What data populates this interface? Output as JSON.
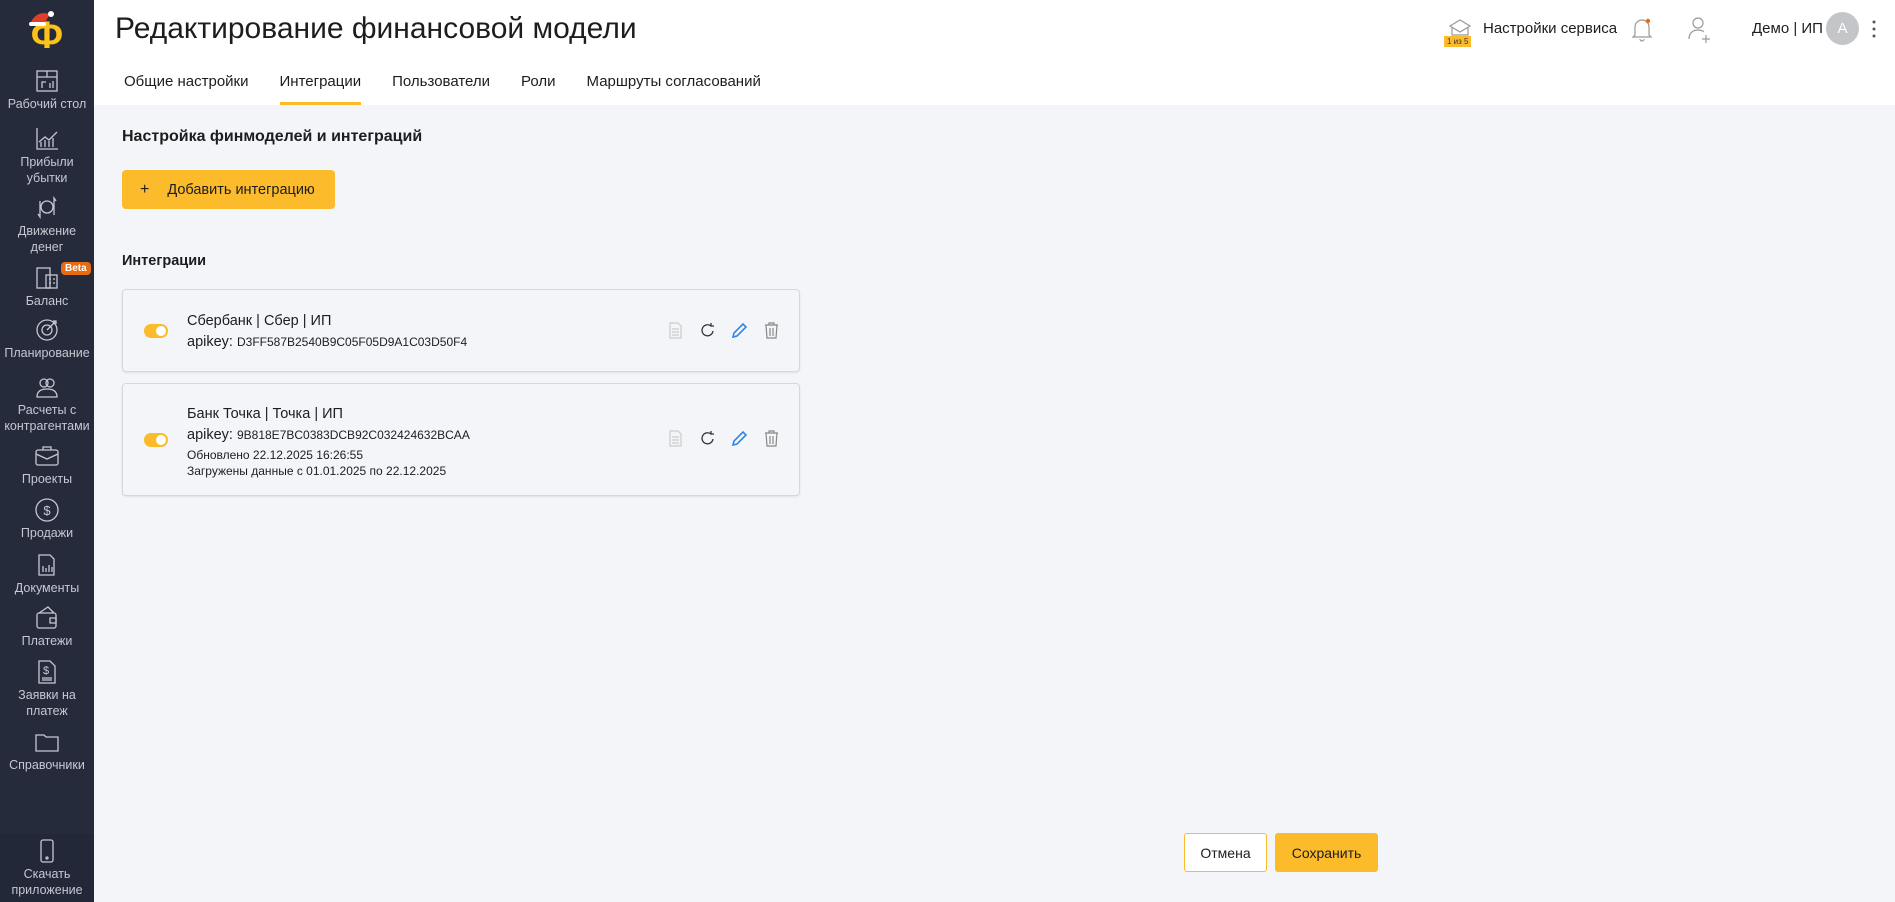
{
  "app": {
    "logo_letter": "Ф"
  },
  "sidebar": {
    "items": [
      {
        "label": "Рабочий стол",
        "icon": "dashboard-icon"
      },
      {
        "label": "Прибыли убытки",
        "icon": "profit-chart-icon"
      },
      {
        "label": "Движение денег",
        "icon": "cash-flow-icon"
      },
      {
        "label": "Баланс",
        "icon": "balance-icon",
        "badge": "Beta"
      },
      {
        "label": "Планирование",
        "icon": "target-icon"
      },
      {
        "label": "Расчеты с контрагентами",
        "icon": "contractors-icon"
      },
      {
        "label": "Проекты",
        "icon": "briefcase-icon"
      },
      {
        "label": "Продажи",
        "icon": "dollar-icon"
      },
      {
        "label": "Документы",
        "icon": "documents-icon"
      },
      {
        "label": "Платежи",
        "icon": "wallet-icon"
      },
      {
        "label": "Заявки на платеж",
        "icon": "payment-request-icon"
      },
      {
        "label": "Справочники",
        "icon": "folder-icon"
      }
    ],
    "download": {
      "label": "Скачать приложение"
    }
  },
  "header": {
    "title": "Редактирование финансовой модели",
    "service_settings": "Настройки сервиса",
    "onboarding_badge": "1 из 5",
    "company": "Демо | ИП",
    "avatar_letter": "А"
  },
  "tabs": [
    {
      "label": "Общие настройки"
    },
    {
      "label": "Интеграции",
      "active": true
    },
    {
      "label": "Пользователи"
    },
    {
      "label": "Роли"
    },
    {
      "label": "Маршруты согласований"
    }
  ],
  "main": {
    "section_title": "Настройка финмоделей и интеграций",
    "add_button": "Добавить интеграцию",
    "list_title": "Интеграции",
    "integrations": [
      {
        "name": "Сбербанк | Сбер | ИП",
        "apikey_label": "apikey:",
        "apikey": "D3FF587B2540B9C05F05D9A1C03D50F4",
        "enabled": true
      },
      {
        "name": "Банк Точка | Точка | ИП",
        "apikey_label": "apikey:",
        "apikey": "9B818E7BC0383DCB92C032424632BCAA",
        "updated": "Обновлено 22.12.2025 16:26:55",
        "loaded": "Загружены данные с 01.01.2025 по 22.12.2025",
        "enabled": true
      }
    ]
  },
  "footer": {
    "cancel": "Отмена",
    "save": "Сохранить"
  },
  "colors": {
    "accent": "#fbbb2a",
    "sidebar": "#262b3b",
    "edit": "#2f86e8"
  }
}
